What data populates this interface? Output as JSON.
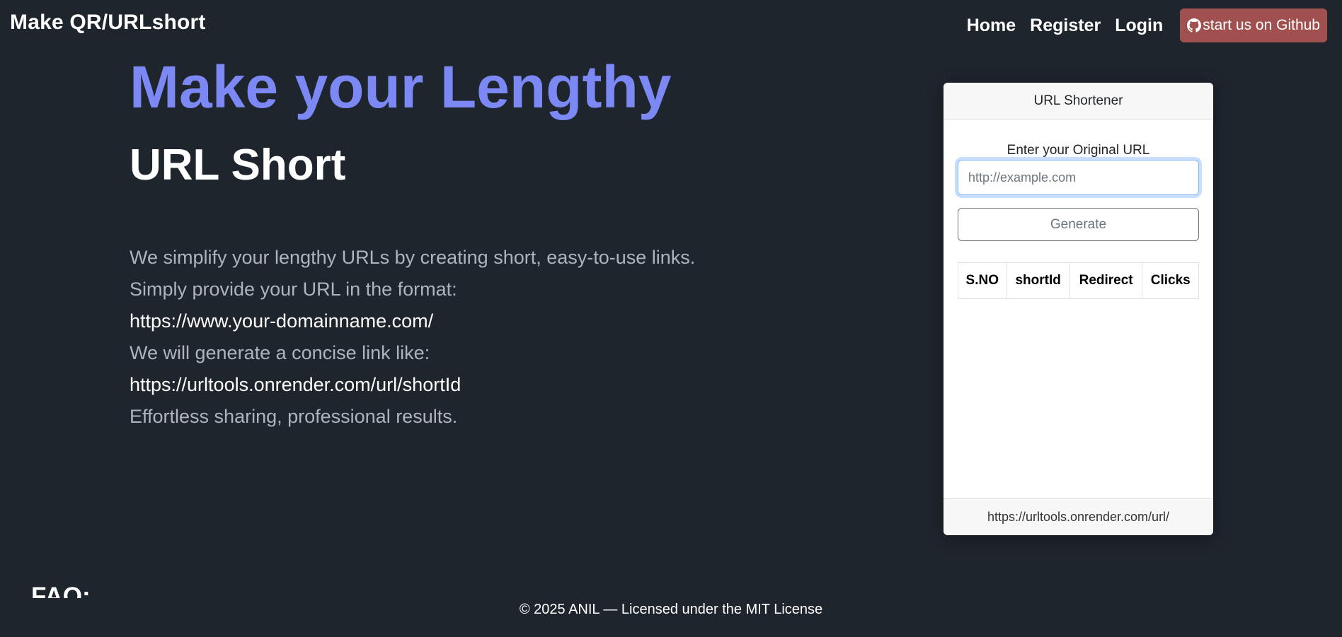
{
  "nav": {
    "brand": "Make QR/URLshort",
    "links": [
      "Home",
      "Register",
      "Login"
    ],
    "github_label": "start us on Github",
    "github_icon": "github-icon",
    "github_color": "#a0504f"
  },
  "hero": {
    "title": "Make your Lengthy",
    "subtitle": "URL Short",
    "title_color": "#7c88f4"
  },
  "description": {
    "line1": "We simplify your lengthy URLs by creating short, easy-to-use links.",
    "line2": "Simply provide your URL in the format:",
    "example_input": "https://www.your-domainname.com/",
    "line3": "We will generate a concise link like:",
    "example_output": "https://urltools.onrender.com/url/shortId",
    "line4": "Effortless sharing, professional results."
  },
  "shortener": {
    "header": "URL Shortener",
    "input_label": "Enter your Original URL",
    "input_placeholder": "http://example.com",
    "input_value": "",
    "generate_label": "Generate",
    "table_headers": [
      "S.NO",
      "shortId",
      "Redirect",
      "Clicks"
    ],
    "footer": "https://urltools.onrender.com/url/"
  },
  "faq": {
    "title": "FAQ:"
  },
  "footer": {
    "text": "© 2025 ANIL — Licensed under the MIT License"
  },
  "colors": {
    "background": "#1f252d",
    "accent": "#7c88f4"
  }
}
